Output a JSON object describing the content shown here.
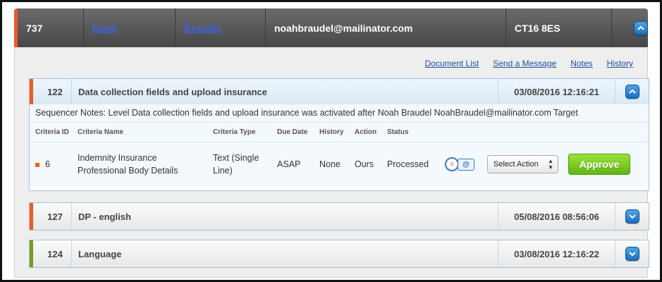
{
  "user": {
    "id": "737",
    "first_name": "Noah",
    "last_name": "Braudel",
    "email": "noahbraudel@mailinator.com",
    "postcode": "CT16 8ES"
  },
  "links": {
    "document_list": "Document List",
    "send_message": "Send a Message",
    "notes": "Notes",
    "history": "History"
  },
  "sequencers": [
    {
      "num": "122",
      "title": "Data collection fields and upload insurance",
      "date": "03/08/2016 12:16:21",
      "expanded": true,
      "notes": "Sequencer Notes: Level Data collection fields and upload insurance was activated after Noah Braudel NoahBraudel@mailinator.com Target",
      "columns": {
        "id": "Criteria ID",
        "name": "Criteria Name",
        "type": "Criteria Type",
        "due": "Due Date",
        "history": "History",
        "action": "Action",
        "status": "Status"
      },
      "rows": [
        {
          "id": "6",
          "name_line1": "Indemnity Insurance",
          "name_line2": "Professional Body Details",
          "type_line1": "Text (Single",
          "type_line2": "Line)",
          "due": "ASAP",
          "history": "None",
          "action": "Ours",
          "status": "Processed",
          "badge_count": "0",
          "select_value": "Select Action",
          "approve_label": "Approve"
        }
      ]
    },
    {
      "num": "127",
      "title": "DP - english",
      "date": "05/08/2016 08:56:06",
      "expanded": false
    },
    {
      "num": "124",
      "title": "Language",
      "date": "03/08/2016 12:16:22",
      "expanded": false
    }
  ],
  "colors": {
    "accent_orange": "#f05a24",
    "accent_green": "#7a9a1e",
    "approve_green": "#6cc21c",
    "link_blue": "#1d4f9c"
  }
}
